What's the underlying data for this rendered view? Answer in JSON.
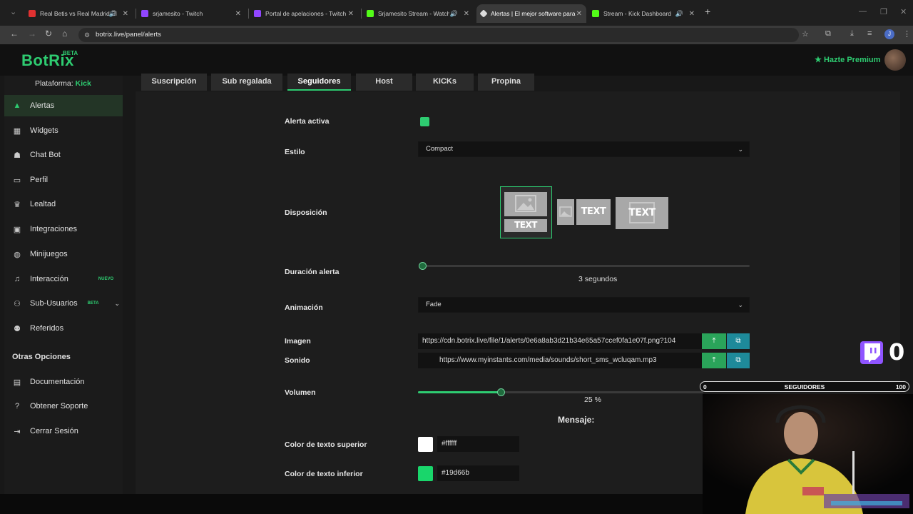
{
  "browser": {
    "tabs": [
      {
        "title": "Real Betis vs Real Madrid El",
        "favicon": "youtube-icon",
        "color": "#e03131",
        "audio": true
      },
      {
        "title": "srjamesito - Twitch",
        "favicon": "twitch-icon",
        "color": "#9146ff",
        "audio": false
      },
      {
        "title": "Portal de apelaciones - Twitch",
        "favicon": "twitch-icon",
        "color": "#9146ff",
        "audio": false
      },
      {
        "title": "Srjamesito Stream - Watch",
        "favicon": "kick-icon",
        "color": "#53fc18",
        "audio": true
      },
      {
        "title": "Alertas | El mejor software para",
        "favicon": "botrix-icon",
        "color": "#dddddd",
        "audio": false,
        "active": true
      },
      {
        "title": "Stream - Kick Dashboard",
        "favicon": "kick-icon",
        "color": "#53fc18",
        "audio": true
      }
    ],
    "url": "botrix.live/panel/alerts",
    "profile_initial": "J"
  },
  "app": {
    "logo": "BotRix",
    "logo_badge": "BETA",
    "premium_label": "Hazte Premium",
    "platform_label": "Plataforma:",
    "platform_value": "Kick"
  },
  "sidebar": {
    "items": [
      {
        "label": "Alertas",
        "icon": "warning-icon",
        "active": true
      },
      {
        "label": "Widgets",
        "icon": "grid-icon"
      },
      {
        "label": "Chat Bot",
        "icon": "robot-icon"
      },
      {
        "label": "Perfil",
        "icon": "id-card-icon"
      },
      {
        "label": "Lealtad",
        "icon": "trophy-icon"
      },
      {
        "label": "Integraciones",
        "icon": "puzzle-icon"
      },
      {
        "label": "Minijuegos",
        "icon": "gamepad-icon"
      },
      {
        "label": "Interacción",
        "icon": "music-icon",
        "badge": "NUEVO"
      },
      {
        "label": "Sub-Usuarios",
        "icon": "users-icon",
        "badge": "BETA"
      },
      {
        "label": "Referidos",
        "icon": "user-group-icon"
      }
    ],
    "other_title": "Otras Opciones",
    "other_items": [
      {
        "label": "Documentación",
        "icon": "book-icon"
      },
      {
        "label": "Obtener Soporte",
        "icon": "help-icon"
      },
      {
        "label": "Cerrar Sesión",
        "icon": "logout-icon"
      }
    ]
  },
  "alert_tabs": [
    "Suscripción",
    "Sub regalada",
    "Seguidores",
    "Host",
    "KICKs",
    "Propina"
  ],
  "alert_tabs_selected": "Seguidores",
  "form": {
    "active_label": "Alerta activa",
    "active_value": true,
    "style_label": "Estilo",
    "style_value": "Compact",
    "layout_label": "Disposición",
    "layout_text": "TEXT",
    "duration_label": "Duración alerta",
    "duration_value": "3",
    "duration_unit": "segundos",
    "duration_fraction": 0.0,
    "animation_label": "Animación",
    "animation_value": "Fade",
    "image_label": "Imagen",
    "image_value": "https://cdn.botrix.live/file/1/alerts/0e6a8ab3d21b34e65a57ccef0fa1e07f.png?104",
    "sound_label": "Sonido",
    "sound_value": "https://www.myinstants.com/media/sounds/short_sms_wcluqam.mp3",
    "volume_label": "Volumen",
    "volume_value": "25",
    "volume_unit": "%",
    "volume_fraction": 0.25,
    "message_title": "Mensaje:",
    "top_color_label": "Color de texto superior",
    "top_color_value": "#ffffff",
    "bottom_color_label": "Color de texto inferior",
    "bottom_color_value": "#19d66b"
  },
  "overlay": {
    "follower_count": "0",
    "goal_min": "0",
    "goal_label": "SEGUIDORES",
    "goal_max": "100"
  },
  "colors": {
    "accent": "#2ecc71",
    "background": "#181818"
  }
}
